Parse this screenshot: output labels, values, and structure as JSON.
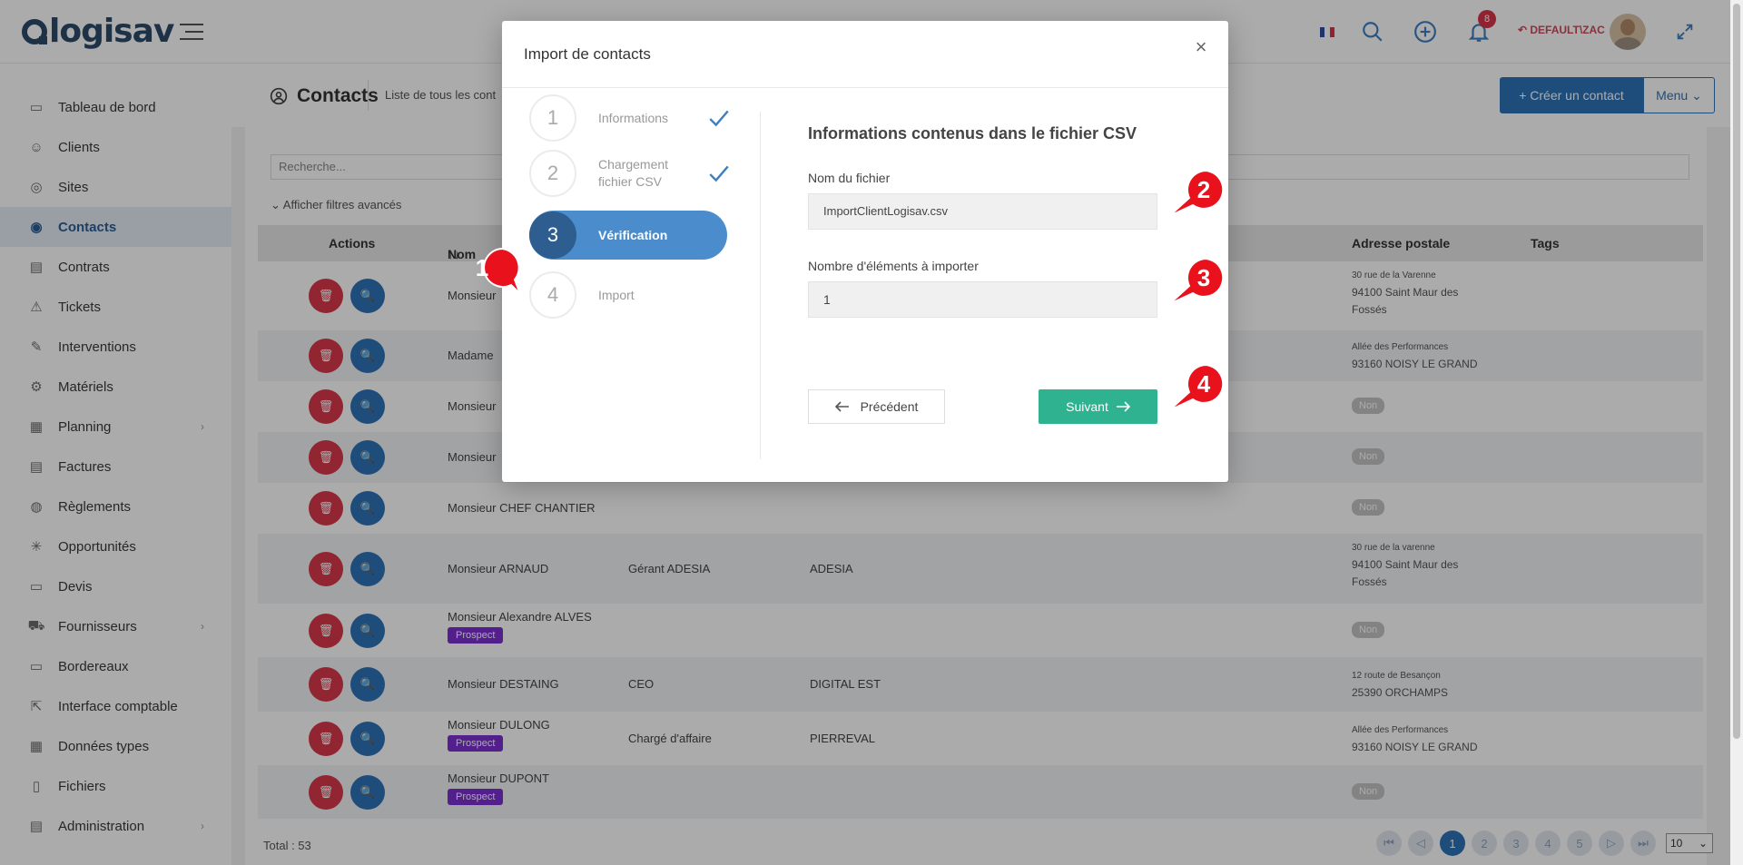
{
  "app": {
    "logo_text": "logisav"
  },
  "topbar": {
    "notification_count": "8",
    "user_label": "DEFAULT\\ZAC"
  },
  "sidebar": {
    "items": [
      {
        "label": "Tableau de bord",
        "icon": "dashboard-icon"
      },
      {
        "label": "Clients",
        "icon": "client-icon"
      },
      {
        "label": "Sites",
        "icon": "location-icon"
      },
      {
        "label": "Contacts",
        "icon": "contacts-icon",
        "active": true
      },
      {
        "label": "Contrats",
        "icon": "contract-icon"
      },
      {
        "label": "Tickets",
        "icon": "warning-icon"
      },
      {
        "label": "Interventions",
        "icon": "wrench-icon"
      },
      {
        "label": "Matériels",
        "icon": "gear-icon"
      },
      {
        "label": "Planning",
        "icon": "calendar-icon",
        "has_children": true
      },
      {
        "label": "Factures",
        "icon": "invoice-icon"
      },
      {
        "label": "Règlements",
        "icon": "payment-icon"
      },
      {
        "label": "Opportunités",
        "icon": "opportunity-icon"
      },
      {
        "label": "Devis",
        "icon": "quote-icon"
      },
      {
        "label": "Fournisseurs",
        "icon": "truck-icon",
        "has_children": true
      },
      {
        "label": "Bordereaux",
        "icon": "slip-icon"
      },
      {
        "label": "Interface comptable",
        "icon": "external-link-icon"
      },
      {
        "label": "Données types",
        "icon": "data-icon"
      },
      {
        "label": "Fichiers",
        "icon": "file-icon"
      },
      {
        "label": "Administration",
        "icon": "admin-icon",
        "has_children": true
      }
    ]
  },
  "page": {
    "title": "Contacts",
    "subtitle": "Liste de tous les cont",
    "create_button": "Créer un contact",
    "menu_button": "Menu",
    "search_placeholder": "Recherche...",
    "advanced_filters": "Afficher filtres avancés"
  },
  "table": {
    "headers": {
      "actions": "Actions",
      "name": "Nom",
      "address": "Adresse postale",
      "tags": "Tags"
    },
    "rows": [
      {
        "name": "Monsieur",
        "function": "",
        "company": "",
        "addr1": "30 rue de la Varenne",
        "addr2": "94100 Saint Maur des",
        "addr3": "Fossés",
        "prospect": "",
        "non": ""
      },
      {
        "name": "Madame",
        "function": "",
        "company": "",
        "addr1": "Allée des Performances",
        "addr2": "93160 NOISY LE GRAND",
        "addr3": "",
        "prospect": "",
        "non": ""
      },
      {
        "name": "Monsieur",
        "function": "",
        "company": "",
        "addr1": "",
        "addr2": "",
        "addr3": "",
        "prospect": "",
        "non": "Non"
      },
      {
        "name": "Monsieur",
        "function": "",
        "company": "",
        "addr1": "",
        "addr2": "",
        "addr3": "",
        "prospect": "",
        "non": "Non"
      },
      {
        "name": "Monsieur CHEF CHANTIER",
        "function": "",
        "company": "",
        "addr1": "",
        "addr2": "",
        "addr3": "",
        "prospect": "",
        "non": "Non"
      },
      {
        "name": "Monsieur ARNAUD",
        "function": "Gérant ADESIA",
        "company": "ADESIA",
        "addr1": "30 rue de la varenne",
        "addr2": "94100 Saint Maur des",
        "addr3": "Fossés",
        "prospect": "",
        "non": ""
      },
      {
        "name": "Monsieur Alexandre ALVES",
        "function": "",
        "company": "",
        "addr1": "",
        "addr2": "",
        "addr3": "",
        "prospect": "Prospect",
        "non": "Non"
      },
      {
        "name": "Monsieur DESTAING",
        "function": "CEO",
        "company": "DIGITAL EST",
        "addr1": "12 route de Besançon",
        "addr2": "25390 ORCHAMPS",
        "addr3": "",
        "prospect": "",
        "non": ""
      },
      {
        "name": "Monsieur DULONG",
        "function": "Chargé d'affaire",
        "company": "PIERREVAL",
        "addr1": "Allée des Performances",
        "addr2": "93160 NOISY LE GRAND",
        "addr3": "",
        "prospect": "Prospect",
        "non": ""
      },
      {
        "name": "Monsieur DUPONT",
        "function": "",
        "company": "",
        "addr1": "",
        "addr2": "",
        "addr3": "",
        "prospect": "Prospect",
        "non": "Non"
      }
    ],
    "total": "Total : 53",
    "pages": [
      "1",
      "2",
      "3",
      "4",
      "5"
    ],
    "page_size": "10"
  },
  "modal": {
    "title": "Import de contacts",
    "steps": [
      {
        "num": "1",
        "label": "Informations",
        "done": true
      },
      {
        "num": "2",
        "label": "Chargement fichier CSV",
        "done": true
      },
      {
        "num": "3",
        "label": "Vérification",
        "active": true
      },
      {
        "num": "4",
        "label": "Import"
      }
    ],
    "form_title": "Informations contenus dans le fichier CSV",
    "filename_label": "Nom du fichier",
    "filename_value": "ImportClientLogisav.csv",
    "count_label": "Nombre d'éléments à importer",
    "count_value": "1",
    "prev_button": "Précédent",
    "next_button": "Suivant"
  },
  "callouts": [
    "1",
    "2",
    "3",
    "4"
  ],
  "colors": {
    "primary": "#2f73b8",
    "success": "#2fb28f",
    "danger": "#d8384a",
    "callout": "#e8111c",
    "prospect": "#7b2fd1"
  }
}
